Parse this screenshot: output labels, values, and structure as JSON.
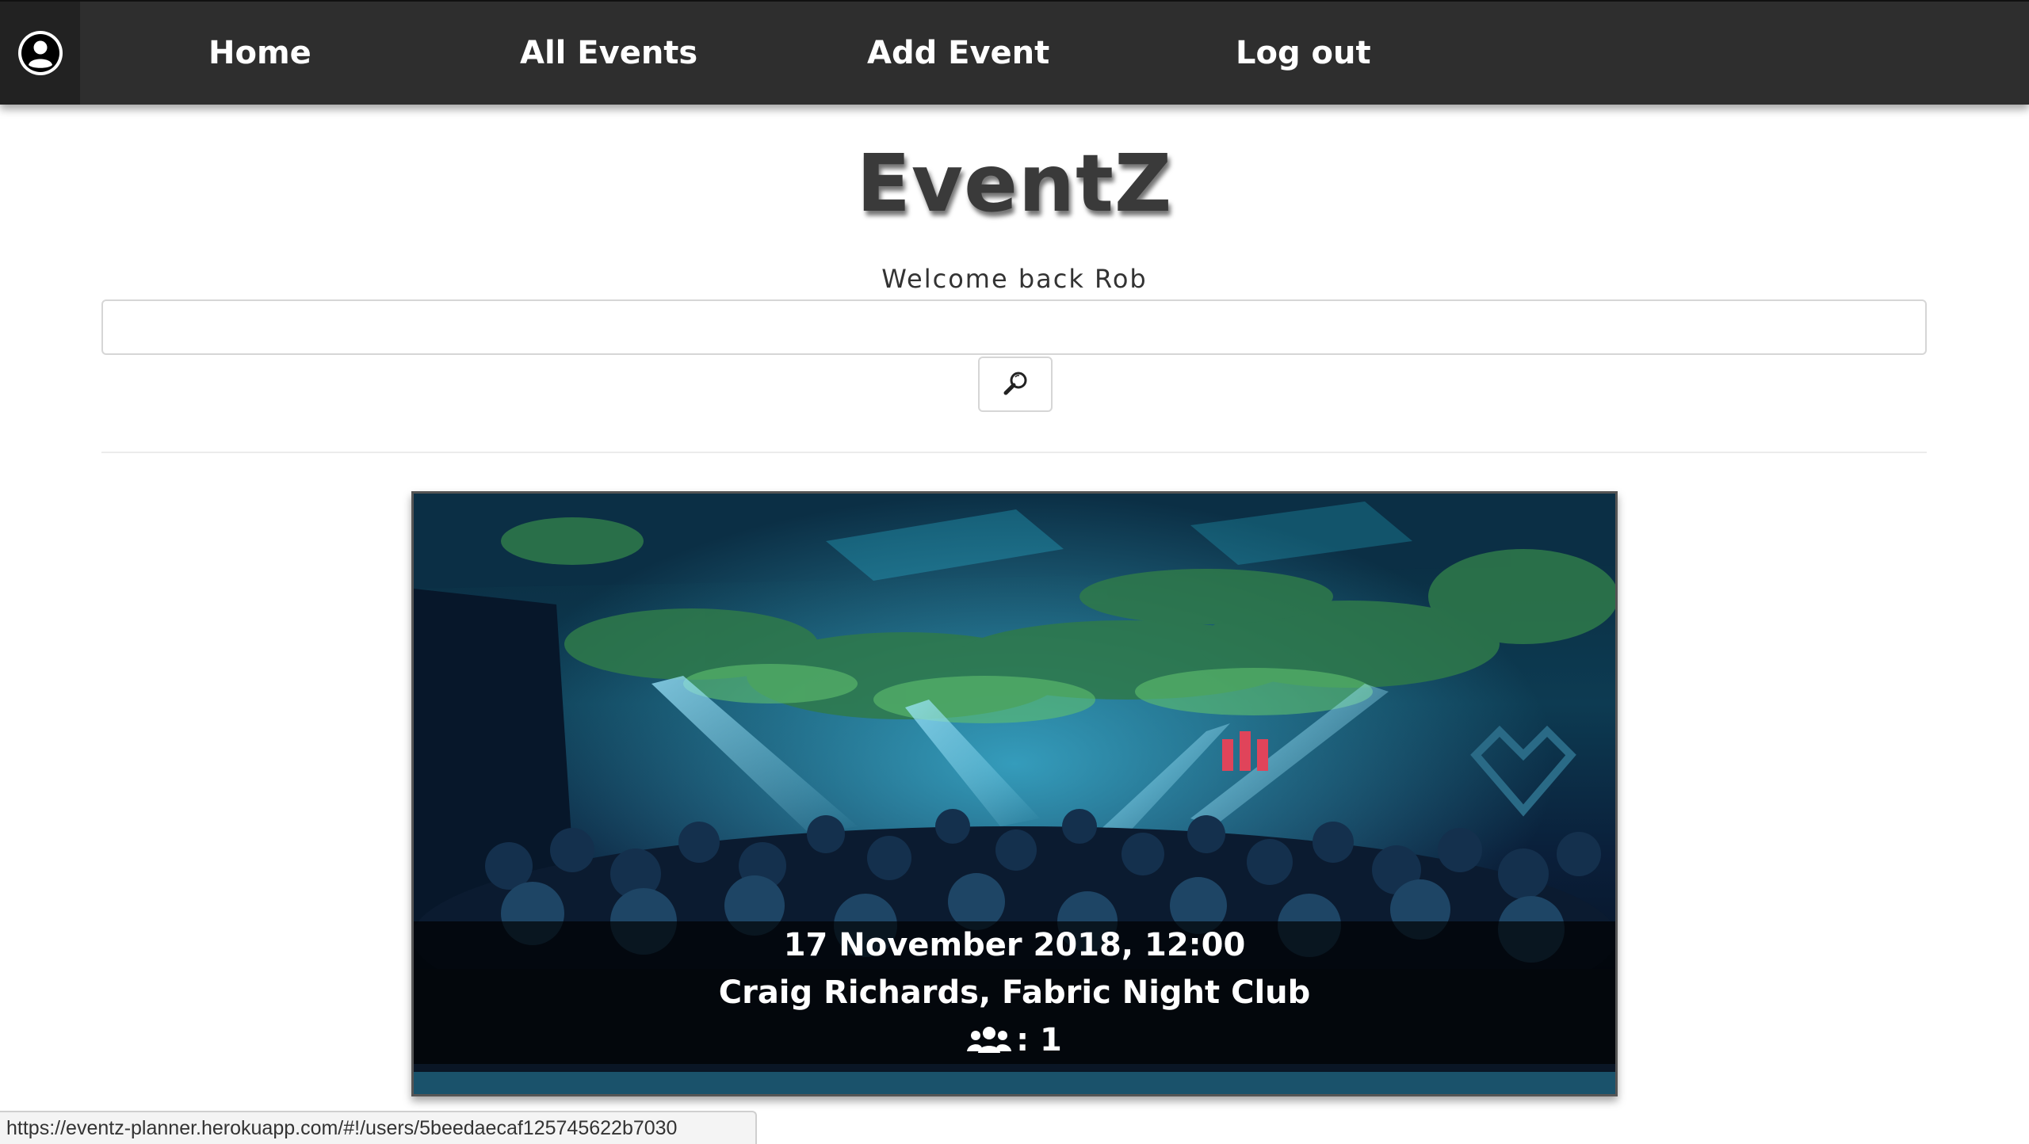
{
  "navbar": {
    "avatar_icon": "user-circle-icon",
    "items": [
      {
        "label": "Home"
      },
      {
        "label": "All Events"
      },
      {
        "label": "Add Event"
      },
      {
        "label": "Log out"
      }
    ],
    "background": "#2e2e2e"
  },
  "brand": {
    "title": "EventZ"
  },
  "welcome": {
    "text": "Welcome back Rob"
  },
  "search": {
    "value": "",
    "placeholder": "",
    "button_icon": "magnifier-icon"
  },
  "event": {
    "image": "nightclub-crowd-photo",
    "datetime": "17 November 2018, 12:00",
    "title": "Craig Richards, Fabric Night Club",
    "attendees_icon": "users-icon",
    "attendees_label": ": 1"
  },
  "status_bar": {
    "url": "https://eventz-planner.herokuapp.com/#!/users/5beedaecaf125745622b7030"
  }
}
